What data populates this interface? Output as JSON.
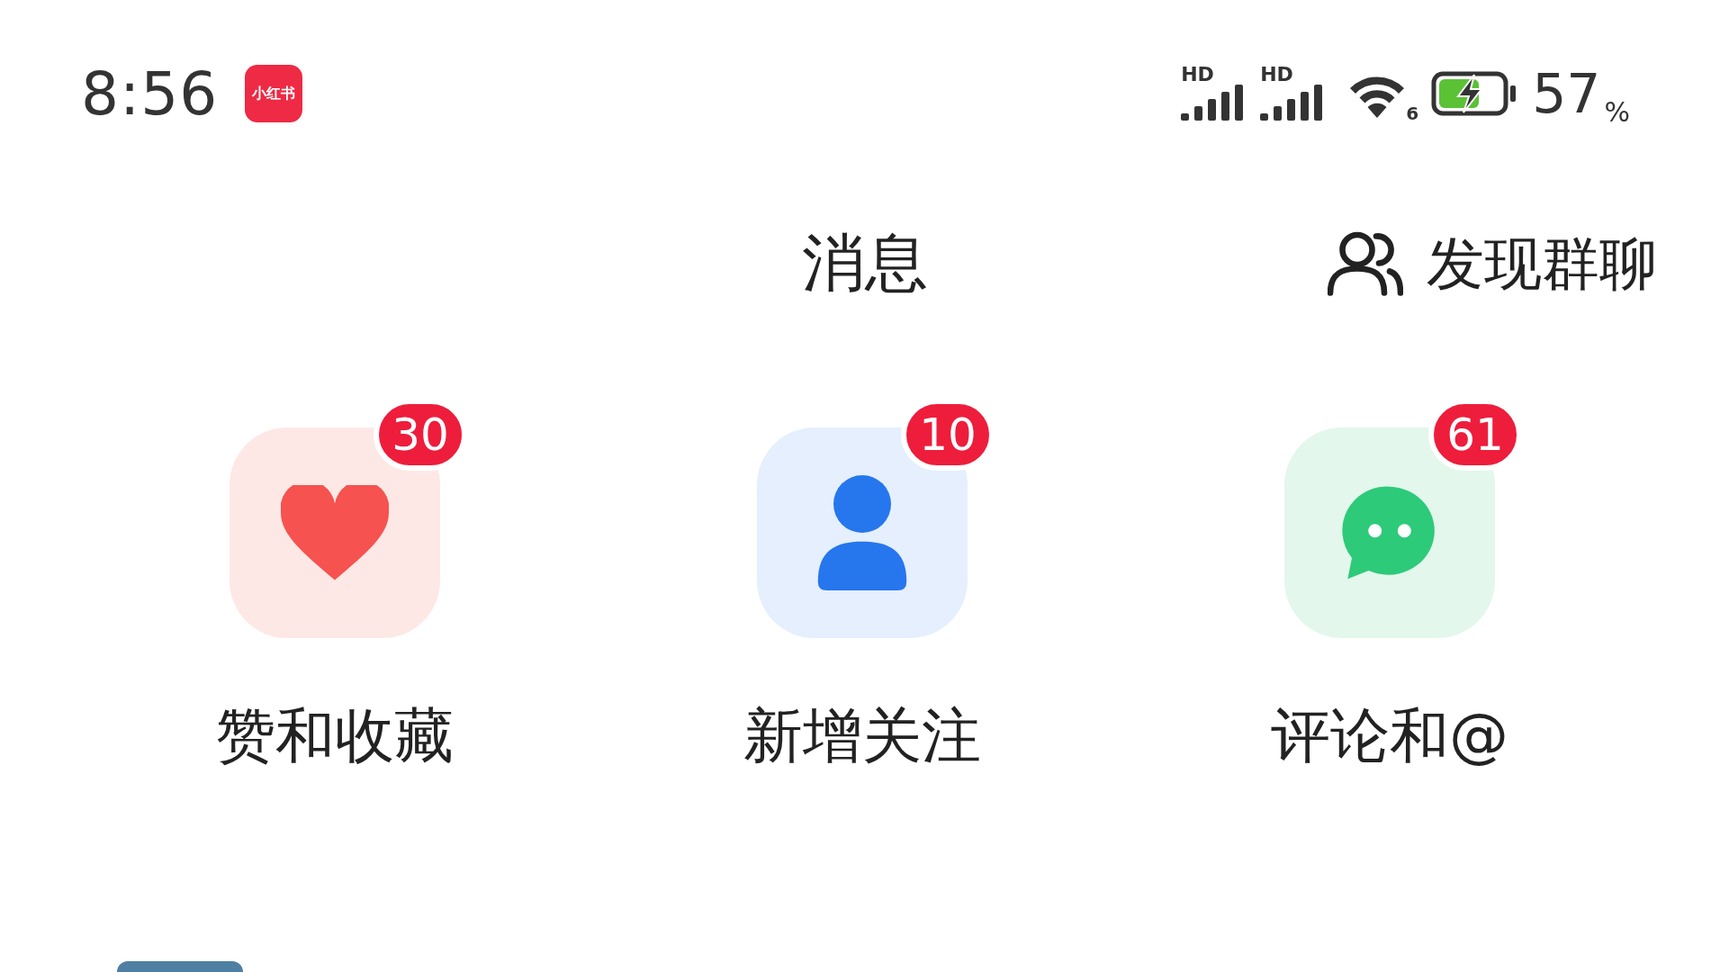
{
  "status_bar": {
    "time": "8:56",
    "app_badge": "小红书",
    "signals": [
      {
        "label": "HD"
      },
      {
        "label": "HD"
      }
    ],
    "wifi_label": "6",
    "charging": true,
    "battery": "57",
    "battery_unit": "%"
  },
  "header": {
    "title": "消息",
    "action": "发现群聊"
  },
  "tiles": [
    {
      "kind": "likes",
      "label": "赞和收藏",
      "count": "30"
    },
    {
      "kind": "follows",
      "label": "新增关注",
      "count": "10"
    },
    {
      "kind": "comments",
      "label": "评论和@",
      "count": "61"
    }
  ]
}
